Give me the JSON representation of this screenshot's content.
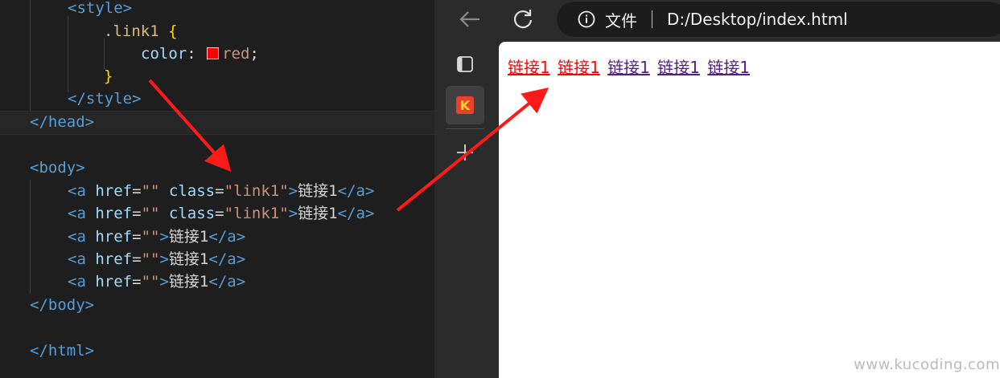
{
  "editor": {
    "lines": {
      "l1": {
        "open": "<",
        "tag": "style",
        "close": ">"
      },
      "l2": {
        "selector": ".link1",
        "brace": " {"
      },
      "l3": {
        "prop": "color",
        "colon": ": ",
        "value": "red",
        "semi": ";"
      },
      "l4": {
        "brace": "}"
      },
      "l5": {
        "open": "</",
        "tag": "style",
        "close": ">"
      },
      "l6": {
        "open": "</",
        "tag": "head",
        "close": ">"
      },
      "l8": {
        "open": "<",
        "tag": "body",
        "close": ">"
      },
      "l9": {
        "open": "<",
        "tag": "a",
        "attr1": "href",
        "eq1": "=",
        "val1": "\"\"",
        "attr2": "class",
        "eq2": "=",
        "val2": "\"link1\"",
        "gt": ">",
        "text": "链接1",
        "closeopen": "</",
        "closetag": "a",
        "closegt": ">"
      },
      "l10": {
        "open": "<",
        "tag": "a",
        "attr1": "href",
        "eq1": "=",
        "val1": "\"\"",
        "attr2": "class",
        "eq2": "=",
        "val2": "\"link1\"",
        "gt": ">",
        "text": "链接1",
        "closeopen": "</",
        "closetag": "a",
        "closegt": ">"
      },
      "l11": {
        "open": "<",
        "tag": "a",
        "attr1": "href",
        "eq1": "=",
        "val1": "\"\"",
        "gt": ">",
        "text": "链接1",
        "closeopen": "</",
        "closetag": "a",
        "closegt": ">"
      },
      "l12": {
        "open": "<",
        "tag": "a",
        "attr1": "href",
        "eq1": "=",
        "val1": "\"\"",
        "gt": ">",
        "text": "链接1",
        "closeopen": "</",
        "closetag": "a",
        "closegt": ">"
      },
      "l13": {
        "open": "<",
        "tag": "a",
        "attr1": "href",
        "eq1": "=",
        "val1": "\"\"",
        "gt": ">",
        "text": "链接1",
        "closeopen": "</",
        "closetag": "a",
        "closegt": ">"
      },
      "l14": {
        "open": "</",
        "tag": "body",
        "close": ">"
      },
      "l16": {
        "open": "</",
        "tag": "html",
        "close": ">"
      }
    },
    "swatch_color": "#ff0000"
  },
  "browser": {
    "back_icon": "arrow-left-icon",
    "reload_icon": "reload-icon",
    "address": {
      "info_icon": "info-icon",
      "label": "文件",
      "url": "D:/Desktop/index.html"
    },
    "sidebar": {
      "tabs_icon": "tab-actions-icon",
      "extension_letter": "K",
      "new_tab_icon": "plus-icon"
    },
    "page": {
      "links": [
        {
          "text": "链接1",
          "color": "#ff0000"
        },
        {
          "text": "链接1",
          "color": "#ff0000"
        },
        {
          "text": "链接1",
          "color": "#551a8b"
        },
        {
          "text": "链接1",
          "color": "#551a8b"
        },
        {
          "text": "链接1",
          "color": "#551a8b"
        }
      ]
    }
  },
  "annotations": {
    "arrow_color": "#ff1a1a"
  },
  "watermark": "www.kucoding.com"
}
